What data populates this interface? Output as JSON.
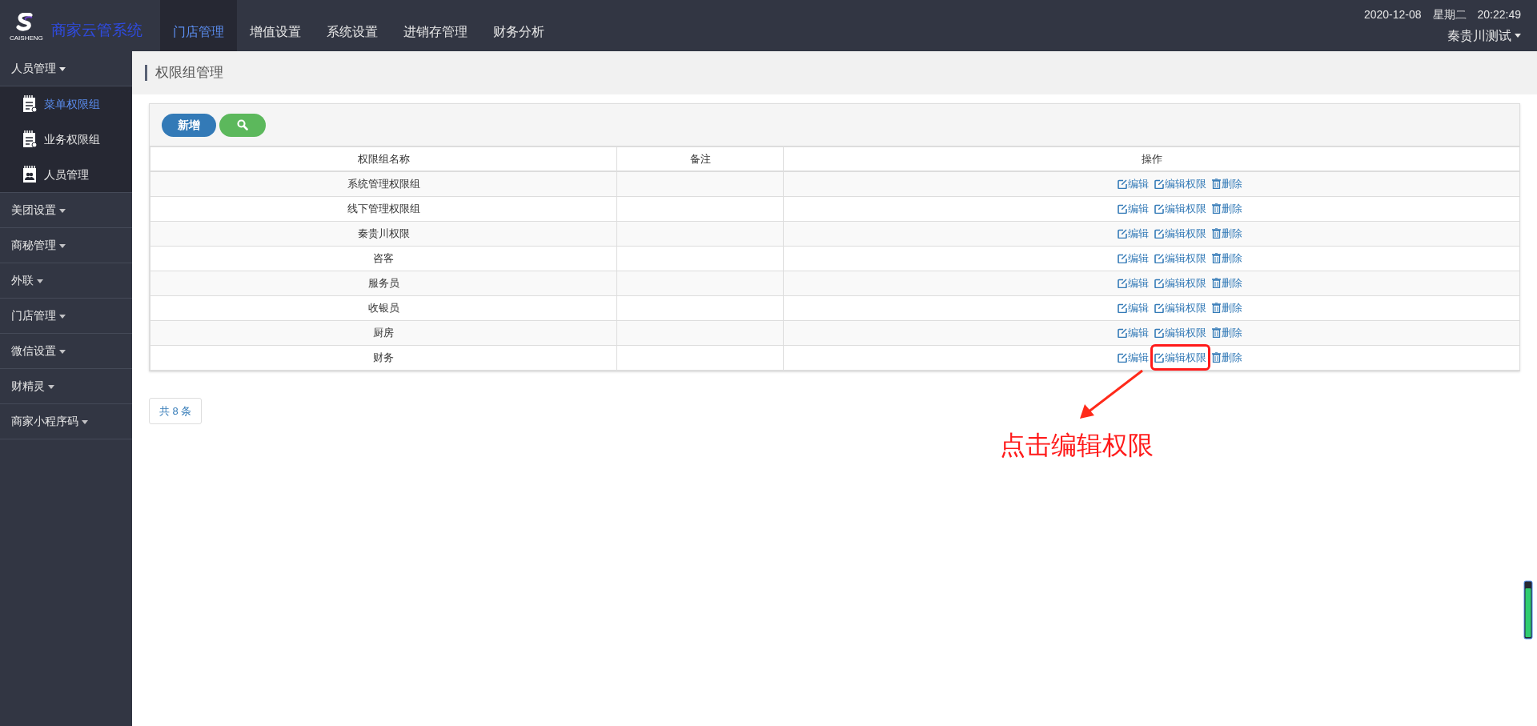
{
  "header": {
    "logo_text": "CAISHENG",
    "title": "商家云管系统",
    "nav": [
      {
        "label": "门店管理",
        "selected": true
      },
      {
        "label": "增值设置",
        "selected": false
      },
      {
        "label": "系统设置",
        "selected": false
      },
      {
        "label": "进销存管理",
        "selected": false
      },
      {
        "label": "财务分析",
        "selected": false
      }
    ],
    "date": "2020-12-08",
    "weekday": "星期二",
    "time": "20:22:49",
    "user": "秦贵川测试"
  },
  "sidebar": {
    "groups": [
      {
        "label": "人员管理",
        "expanded": true,
        "children": [
          {
            "label": "菜单权限组",
            "kind": "notebook",
            "selected": true
          },
          {
            "label": "业务权限组",
            "kind": "notebook",
            "selected": false
          },
          {
            "label": "人员管理",
            "kind": "people",
            "selected": false
          }
        ]
      },
      {
        "label": "美团设置",
        "expanded": false
      },
      {
        "label": "商秘管理",
        "expanded": false
      },
      {
        "label": "外联",
        "expanded": false
      },
      {
        "label": "门店管理",
        "expanded": false
      },
      {
        "label": "微信设置",
        "expanded": false
      },
      {
        "label": "财精灵",
        "expanded": false
      },
      {
        "label": "商家小程序码",
        "expanded": false
      }
    ]
  },
  "page_title": "权限组管理",
  "toolbar": {
    "add_button": "新增"
  },
  "table": {
    "columns": [
      "权限组名称",
      "备注",
      "操作"
    ],
    "rows": [
      {
        "name": "系统管理权限组",
        "actions": [
          "编辑",
          "编辑权限",
          "删除"
        ],
        "highlighted": false
      },
      {
        "name": "线下管理权限组",
        "actions": [
          "编辑",
          "编辑权限",
          "删除"
        ],
        "highlighted": false
      },
      {
        "name": "秦贵川权限",
        "actions": [
          "编辑",
          "编辑权限",
          "删除"
        ],
        "highlighted": false
      },
      {
        "name": "咨客",
        "actions": [
          "编辑",
          "编辑权限",
          "删除"
        ],
        "highlighted": false
      },
      {
        "name": "服务员",
        "actions": [
          "编辑",
          "编辑权限",
          "删除"
        ],
        "highlighted": false
      },
      {
        "name": "收银员",
        "actions": [
          "编辑",
          "编辑权限",
          "删除"
        ],
        "highlighted": false
      },
      {
        "name": "厨房",
        "actions": [
          "编辑",
          "编辑权限",
          "删除"
        ],
        "highlighted": false
      },
      {
        "name": "财务",
        "actions": [
          "编辑",
          "编辑权限",
          "删除"
        ],
        "highlighted": true
      }
    ]
  },
  "pagination": {
    "total": "共 8 条"
  },
  "annotation": {
    "text": "点击编辑权限"
  }
}
